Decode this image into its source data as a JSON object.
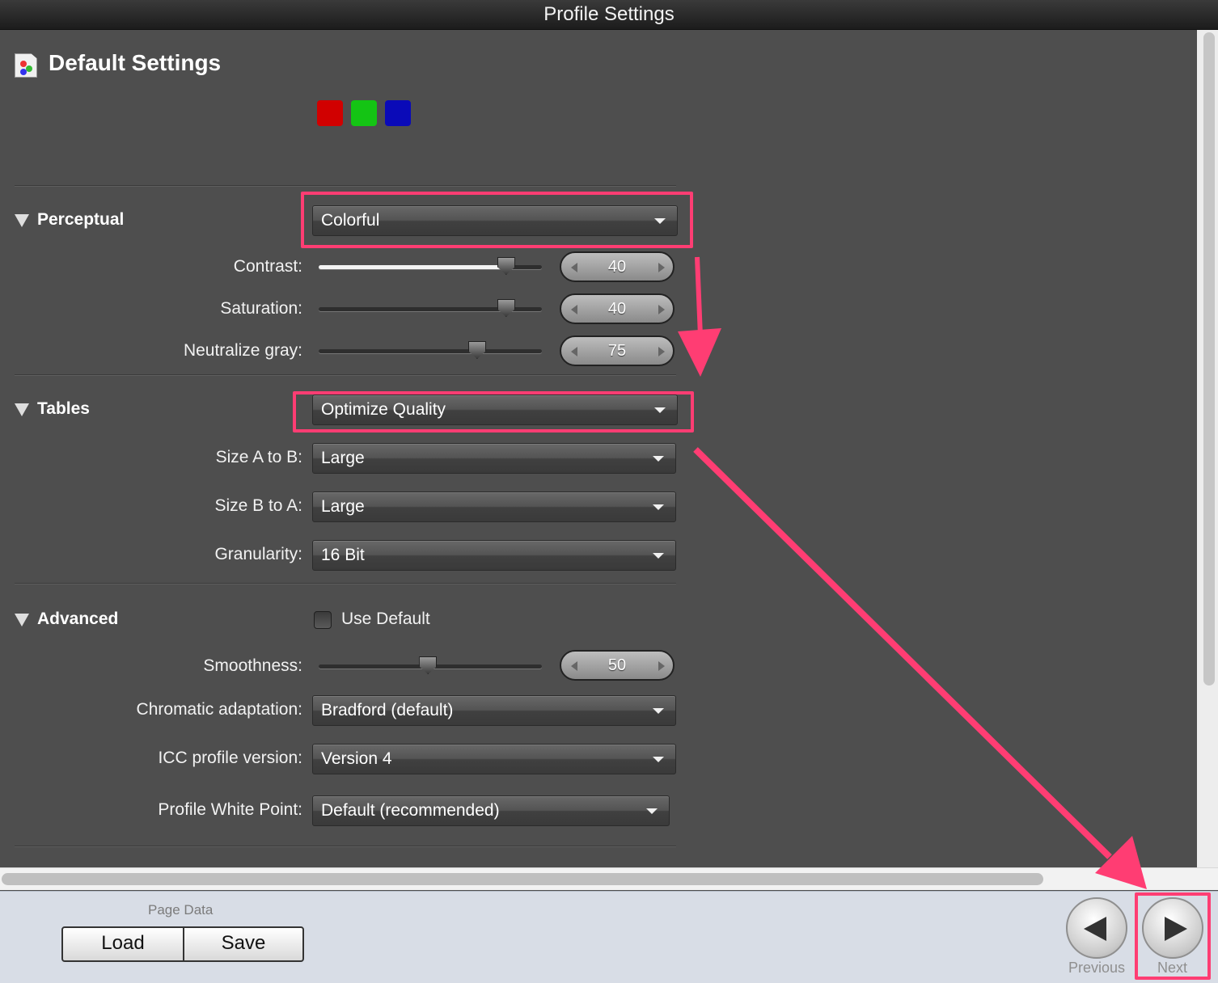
{
  "window": {
    "title": "Profile Settings"
  },
  "header": {
    "title": "Default Settings"
  },
  "swatches": [
    "#d10000",
    "#14c414",
    "#0a0ab8"
  ],
  "perceptual": {
    "title": "Perceptual",
    "mode": "Colorful",
    "contrast": {
      "label": "Contrast:",
      "value": "40"
    },
    "saturation": {
      "label": "Saturation:",
      "value": "40"
    },
    "neutralize_gray": {
      "label": "Neutralize gray:",
      "value": "75"
    }
  },
  "tables": {
    "title": "Tables",
    "mode": "Optimize Quality",
    "size_a_to_b": {
      "label": "Size A to B:",
      "value": "Large"
    },
    "size_b_to_a": {
      "label": "Size B to A:",
      "value": "Large"
    },
    "granularity": {
      "label": "Granularity:",
      "value": "16 Bit"
    }
  },
  "advanced": {
    "title": "Advanced",
    "use_default_label": "Use Default",
    "use_default_checked": false,
    "smoothness": {
      "label": "Smoothness:",
      "value": "50"
    },
    "chromatic_adaptation": {
      "label": "Chromatic adaptation:",
      "value": "Bradford (default)"
    },
    "icc_profile_version": {
      "label": "ICC profile version:",
      "value": "Version 4"
    },
    "profile_white_point": {
      "label": "Profile White Point:",
      "value": "Default (recommended)"
    }
  },
  "footer": {
    "page_data_label": "Page Data",
    "load_label": "Load",
    "save_label": "Save",
    "previous_label": "Previous",
    "next_label": "Next"
  },
  "annotation_color": "#ff3d73"
}
